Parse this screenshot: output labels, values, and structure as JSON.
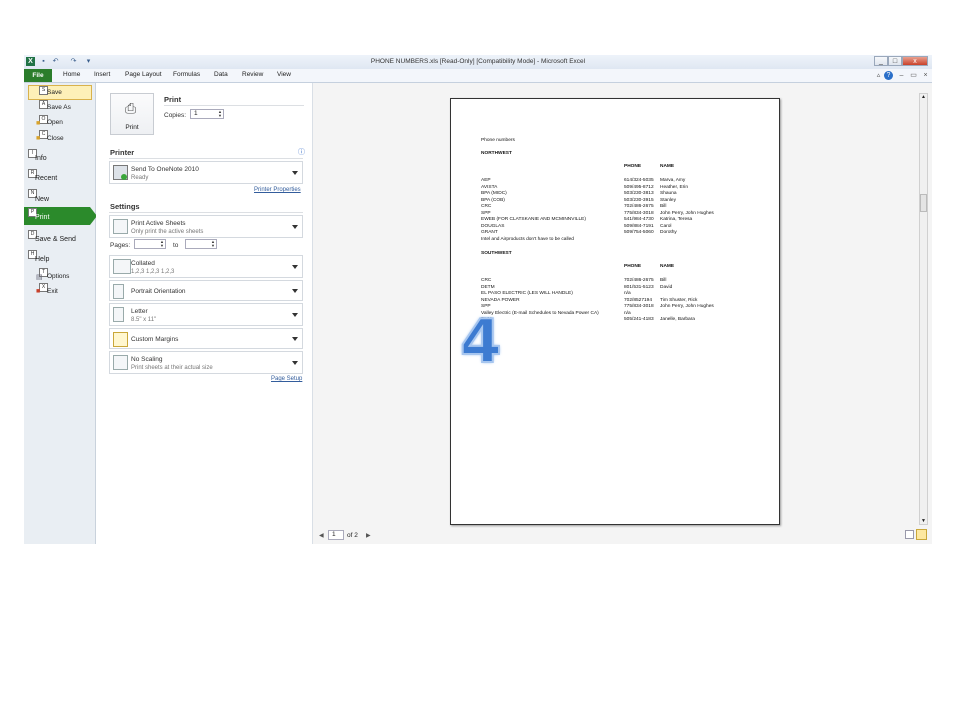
{
  "window": {
    "title": "PHONE NUMBERS.xls  [Read-Only]  [Compatibility Mode]  -  Microsoft Excel",
    "controls": [
      "_",
      "□",
      "x"
    ]
  },
  "ribbon": {
    "file": "File",
    "tabs": [
      "Home",
      "Insert",
      "Page Layout",
      "Formulas",
      "Data",
      "Review",
      "View"
    ]
  },
  "nav": {
    "save": "Save",
    "save_key": "S",
    "save_as": "Save As",
    "save_as_key": "A",
    "open": "Open",
    "open_key": "O",
    "close": "Close",
    "close_key": "C",
    "info": "Info",
    "info_key": "I",
    "recent": "Recent",
    "recent_key": "R",
    "new": "New",
    "new_key": "N",
    "print": "Print",
    "print_key": "P",
    "save_send": "Save & Send",
    "save_send_key": "D",
    "help": "Help",
    "help_key": "H",
    "options": "Options",
    "options_key": "T",
    "exit": "Exit",
    "exit_key": "X"
  },
  "print": {
    "heading": "Print",
    "button": "Print",
    "copies_label": "Copies:",
    "copies_value": "1",
    "printer_heading": "Printer",
    "printer_name": "Send To OneNote 2010",
    "printer_status": "Ready",
    "printer_properties": "Printer Properties",
    "settings_heading": "Settings",
    "what_title": "Print Active Sheets",
    "what_sub": "Only print the active sheets",
    "pages_label": "Pages:",
    "to_label": "to",
    "collated_title": "Collated",
    "collated_sub": "1,2,3    1,2,3    1,2,3",
    "orientation": "Portrait Orientation",
    "paper_title": "Letter",
    "paper_sub": "8.5\" x 11\"",
    "margins": "Custom Margins",
    "scaling_title": "No Scaling",
    "scaling_sub": "Print sheets at their actual size",
    "page_setup": "Page Setup"
  },
  "preview": {
    "page_current": "1",
    "page_total": "of 2",
    "sheet_title": "Phone numbers",
    "section1": "NORTHWEST",
    "section2": "SOUTHWEST",
    "col_phone": "PHONE",
    "col_name": "NAME",
    "northwest": [
      {
        "org": "AEP",
        "phone": "614/324-5035",
        "name": "Marva, Amy"
      },
      {
        "org": "AVISTA",
        "phone": "509/495-8712",
        "name": "Heather, Erin"
      },
      {
        "org": "BPA  (MIDC)",
        "phone": "503/230-3813",
        "name": "Shauna"
      },
      {
        "org": "BPA  (COB)",
        "phone": "503/230-3915",
        "name": "Stanley"
      },
      {
        "org": "CRC",
        "phone": "702/486-2675",
        "name": "Bill"
      },
      {
        "org": "SPP",
        "phone": "775/834-3018",
        "name": "John Perry, John Hughes"
      },
      {
        "org": "EWEB (FOR CLATSKANIE AND MCMINNVILLE)",
        "phone": "541/984-4730",
        "name": "Katrina, Teresa"
      },
      {
        "org": "DOUGLAS",
        "phone": "509/884-7191",
        "name": "Carol"
      },
      {
        "org": "GRANT",
        "phone": "509/754-5060",
        "name": "Dorothy"
      }
    ],
    "note": "Intel and Airproducts don't have to be called",
    "southwest": [
      {
        "org": "CRC",
        "phone": "702/486-2675",
        "name": "Bill"
      },
      {
        "org": "DETM",
        "phone": "801/531-5123",
        "name": "David"
      },
      {
        "org": "EL PASO ELECTRIC (LES WILL HANDLE)",
        "phone": "n/a",
        "name": ""
      },
      {
        "org": "NEVADA POWER",
        "phone": "702/8527194",
        "name": "Tim Shuster, Rick"
      },
      {
        "org": "SPP",
        "phone": "775/834-3018",
        "name": "John Perry, John Hughes"
      },
      {
        "org": "Valley Electric (E-mail Schedules to Nevada Power CA)",
        "phone": "n/a",
        "name": ""
      },
      {
        "org": "PNM",
        "phone": "505/241-4183",
        "name": "Janelle, Barbara"
      }
    ]
  },
  "annotation": "4",
  "colors": {
    "file_tab": "#2b7d2b",
    "print_selected": "#2b8a2b",
    "annotation": "#3d7bd1"
  }
}
